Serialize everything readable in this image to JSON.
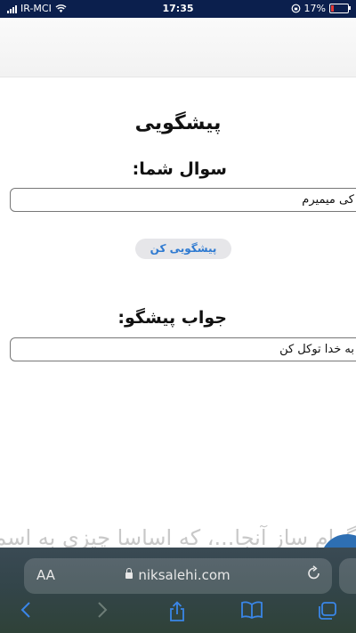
{
  "status_bar": {
    "carrier": "IR-MCI",
    "time": "17:35",
    "battery_percent": "17%",
    "battery_level": 0.17
  },
  "page": {
    "title": "پیشگویی",
    "question_label": "سوال شما:",
    "question_value": "کی میمیرم",
    "predict_button": "پیشگویی کن",
    "answer_label": "جواب پیشگو:",
    "answer_value": "به خدا توکل کن",
    "bleed_text": "گرام ساز آنجا...، که اساسا چیزی به اسم"
  },
  "safari": {
    "text_size_label": "AA",
    "url": "niksalehi.com"
  },
  "icons": [
    "signal-icon",
    "wifi-icon",
    "orientation-lock-icon",
    "battery-icon",
    "lock-icon",
    "reload-icon",
    "back-icon",
    "forward-icon",
    "share-icon",
    "bookmarks-icon",
    "tabs-icon"
  ],
  "colors": {
    "status_bar": "#0b1f4d",
    "button_text": "#2e7ad1",
    "button_bg": "#e6e6e9",
    "toolbar_icon": "#3a86e8",
    "battery_low": "#e53935"
  }
}
